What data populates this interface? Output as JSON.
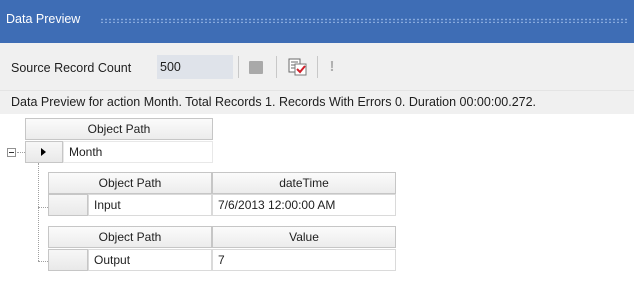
{
  "window": {
    "title": "Data Preview"
  },
  "toolbar": {
    "source_record_count_label": "Source Record Count",
    "source_record_count_value": "500",
    "buttons": [
      "stop-icon",
      "preview-document-check-icon",
      "exclamation-icon"
    ]
  },
  "status": {
    "text": "Data Preview for action Month. Total Records 1. Records With Errors 0. Duration 00:00:00.272."
  },
  "grid": {
    "root": {
      "column_header": "Object Path",
      "row_value": "Month"
    },
    "children": [
      {
        "columns": [
          "Object Path",
          "dateTime"
        ],
        "row": [
          "Input",
          "7/6/2013 12:00:00 AM"
        ]
      },
      {
        "columns": [
          "Object Path",
          "Value"
        ],
        "row": [
          "Output",
          "7"
        ]
      }
    ]
  }
}
